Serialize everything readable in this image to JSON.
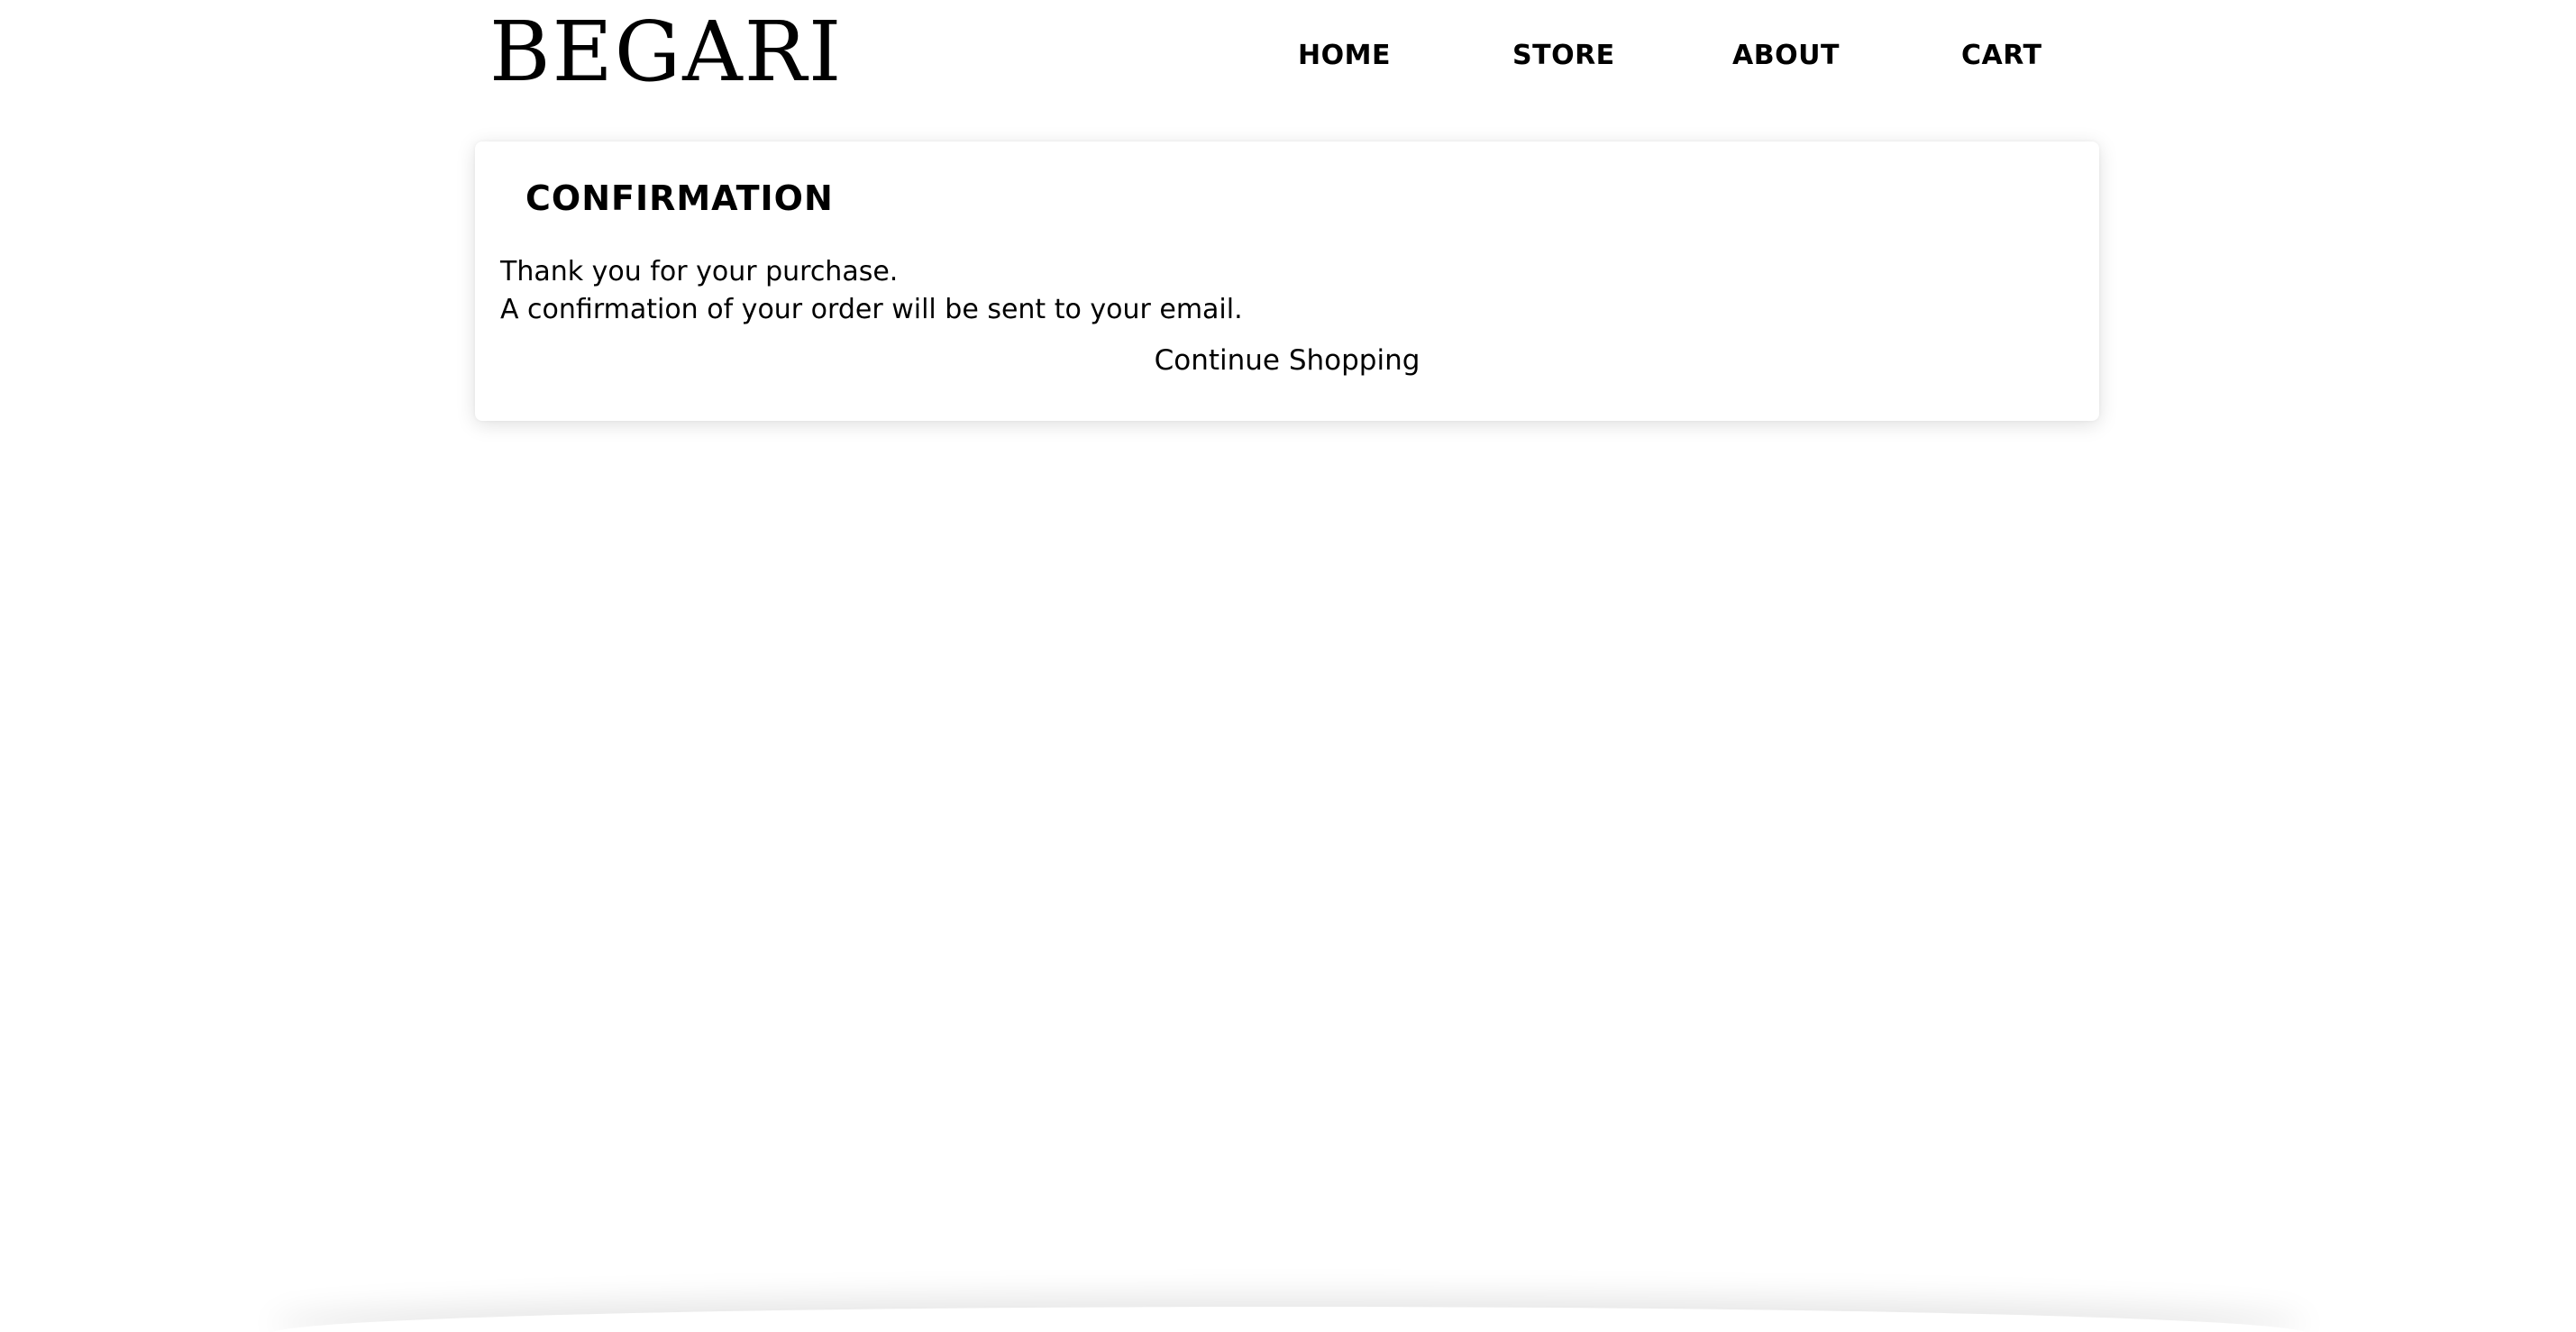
{
  "header": {
    "logo_text": "BEGARI",
    "nav": {
      "home": "HOME",
      "store": "STORE",
      "about": "ABOUT",
      "cart": "CART"
    }
  },
  "confirmation": {
    "title": "CONFIRMATION",
    "line1": "Thank you for your purchase.",
    "line2": "A confirmation of your order will be sent to your email.",
    "continue_label": "Continue Shopping"
  },
  "colors": {
    "background": "#ffffff",
    "text": "#000000"
  }
}
